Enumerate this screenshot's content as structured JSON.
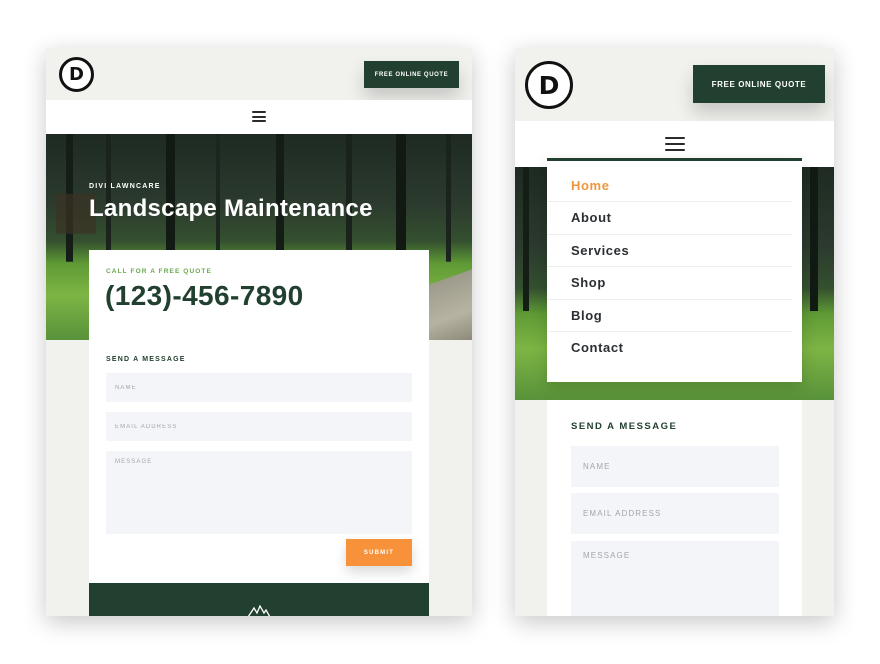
{
  "left": {
    "logo_letter": "D",
    "quote_button": "FREE ONLINE QUOTE",
    "hero_kicker": "DIVI LAWNCARE",
    "hero_title": "Landscape Maintenance",
    "call_label": "CALL FOR A FREE QUOTE",
    "phone": "(123)-456-7890",
    "form_title": "SEND A MESSAGE",
    "name_placeholder": "NAME",
    "email_placeholder": "EMAIL ADDRESS",
    "message_placeholder": "MESSAGE",
    "submit": "SUBMIT"
  },
  "right": {
    "logo_letter": "D",
    "quote_button": "FREE ONLINE QUOTE",
    "menu": [
      {
        "label": "Home",
        "active": true
      },
      {
        "label": "About",
        "active": false
      },
      {
        "label": "Services",
        "active": false
      },
      {
        "label": "Shop",
        "active": false
      },
      {
        "label": "Blog",
        "active": false
      },
      {
        "label": "Contact",
        "active": false
      }
    ],
    "form_title": "SEND A MESSAGE",
    "name_placeholder": "NAME",
    "email_placeholder": "EMAIL ADDRESS",
    "message_placeholder": "MESSAGE"
  },
  "colors": {
    "brand_green": "#22402f",
    "accent_orange": "#f7923a",
    "active_menu": "#f0973d",
    "label_green": "#6aa84f",
    "page_bg": "#f1f2ee"
  }
}
